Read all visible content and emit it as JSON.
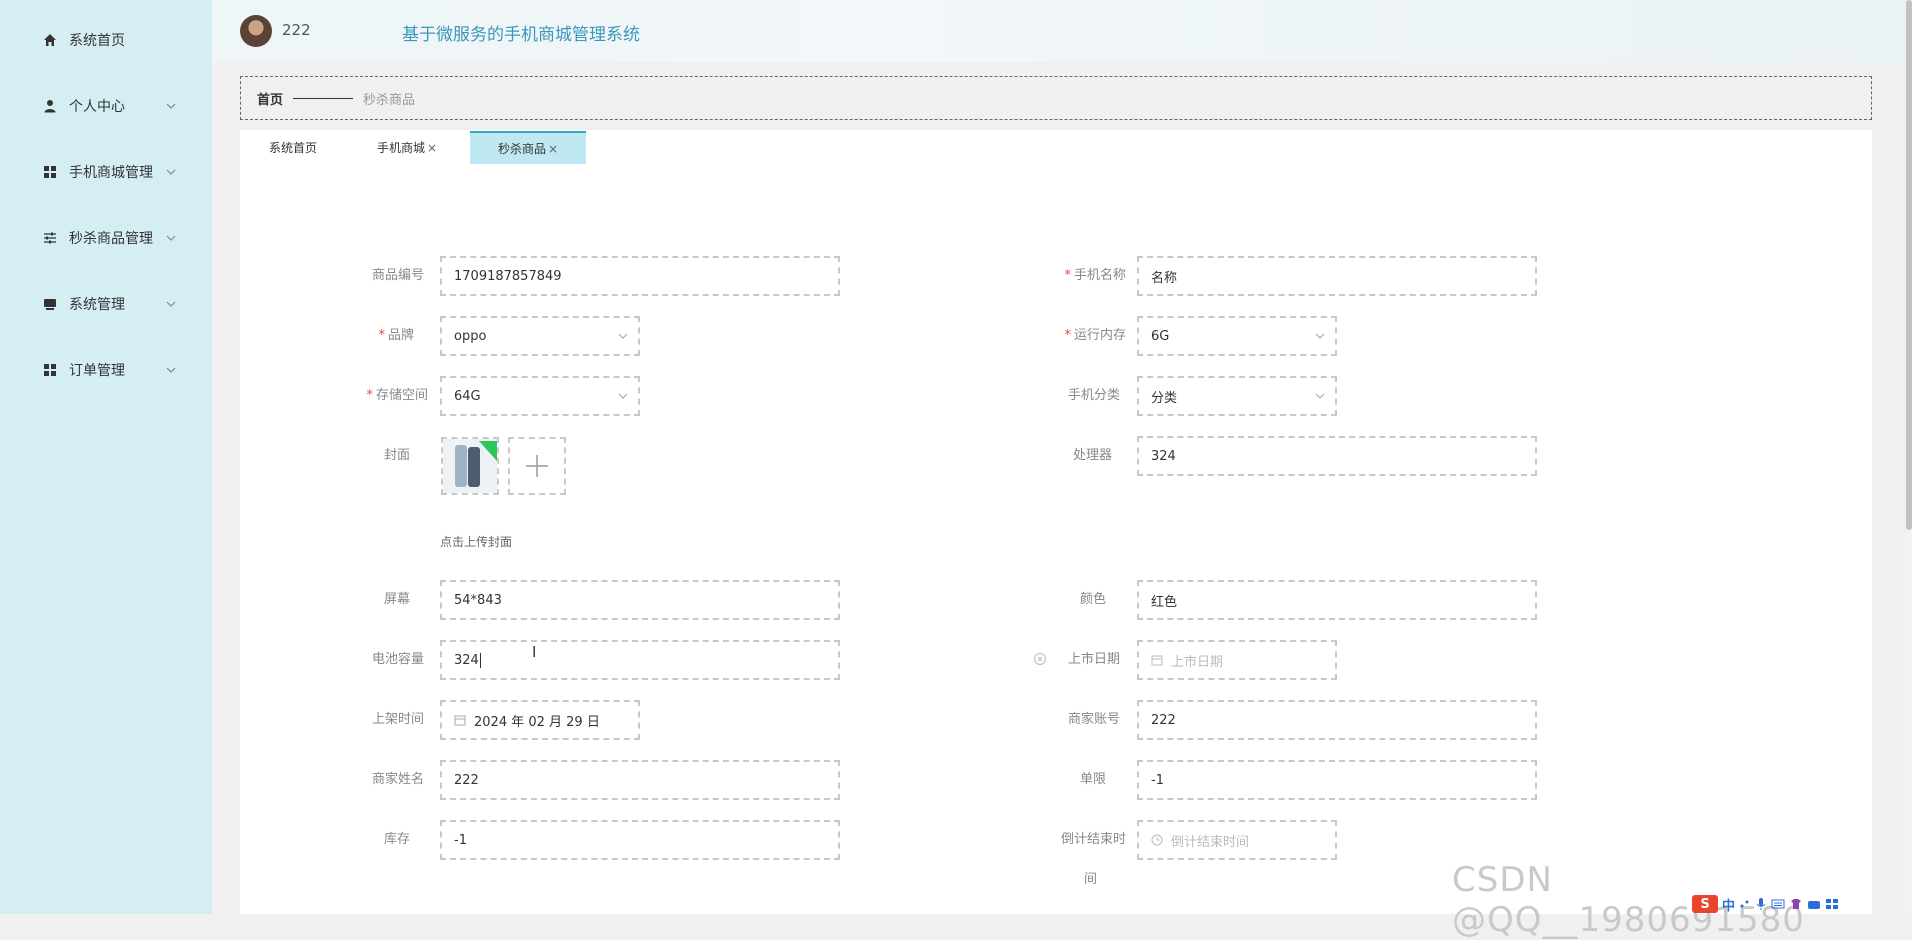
{
  "sidebar": {
    "items": [
      {
        "label": "系统首页",
        "icon": "home-icon",
        "has_submenu": false
      },
      {
        "label": "个人中心",
        "icon": "user-icon",
        "has_submenu": true
      },
      {
        "label": "手机商城管理",
        "icon": "grid-icon",
        "has_submenu": true
      },
      {
        "label": "秒杀商品管理",
        "icon": "sliders-icon",
        "has_submenu": true
      },
      {
        "label": "系统管理",
        "icon": "monitor-icon",
        "has_submenu": true
      },
      {
        "label": "订单管理",
        "icon": "grid-icon",
        "has_submenu": true
      }
    ]
  },
  "header": {
    "username": "222",
    "title": "基于微服务的手机商城管理系统"
  },
  "breadcrumb": {
    "home": "首页",
    "current": "秒杀商品"
  },
  "tabs": [
    {
      "label": "系统首页",
      "closable": false,
      "active": false
    },
    {
      "label": "手机商城",
      "closable": true,
      "active": false
    },
    {
      "label": "秒杀商品",
      "closable": true,
      "active": true
    }
  ],
  "tab_close_glyph": "×",
  "form": {
    "product_no": {
      "label": "商品编号",
      "value": "1709187857849",
      "required": false
    },
    "phone_name": {
      "label": "手机名称",
      "value": "名称",
      "required": true
    },
    "brand": {
      "label": "品牌",
      "value": "oppo",
      "required": true
    },
    "ram": {
      "label": "运行内存",
      "value": "6G",
      "required": true
    },
    "storage": {
      "label": "存储空间",
      "value": "64G",
      "required": true
    },
    "category": {
      "label": "手机分类",
      "value": "分类",
      "required": false
    },
    "cover": {
      "label": "封面",
      "hint": "点击上传封面",
      "required": false
    },
    "processor": {
      "label": "处理器",
      "value": "324",
      "required": false
    },
    "screen": {
      "label": "屏幕",
      "value": "54*843",
      "required": false
    },
    "color": {
      "label": "颜色",
      "value": "红色",
      "required": false
    },
    "battery": {
      "label": "电池容量",
      "value": "324",
      "required": false
    },
    "release_date": {
      "label": "上市日期",
      "placeholder": "上市日期",
      "required": false
    },
    "listing_time": {
      "label": "上架时间",
      "value": "2024 年 02 月 29 日",
      "required": false
    },
    "merchant_account": {
      "label": "商家账号",
      "value": "222",
      "required": false
    },
    "merchant_name": {
      "label": "商家姓名",
      "value": "222",
      "required": false
    },
    "limit": {
      "label": "单限",
      "value": "-1",
      "required": false
    },
    "stock": {
      "label": "库存",
      "value": "-1",
      "required": false
    },
    "countdown_end": {
      "label_line1": "倒计结束时",
      "label_line2": "间",
      "placeholder": "倒计结束时间",
      "required": false
    }
  },
  "watermark": "CSDN @QQ__1980691580",
  "tray": {
    "logo": "S",
    "lang": "中"
  },
  "colors": {
    "sidebar_bg": "#d4eef3",
    "accent": "#3a98b9",
    "active_tab": "#bfe8f3",
    "required": "#e44444"
  }
}
